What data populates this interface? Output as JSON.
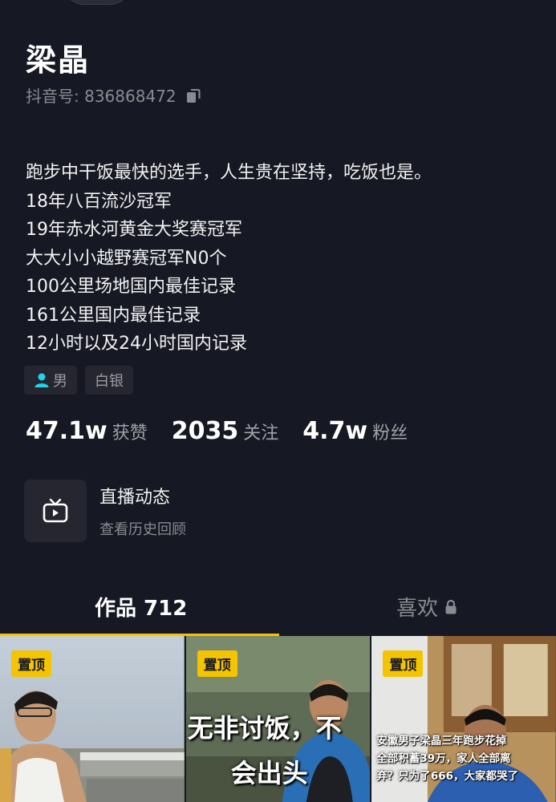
{
  "profile": {
    "name": "梁晶",
    "douyin_id_label": "抖音号: 836868472",
    "bio_lines": [
      "跑步中干饭最快的选手，人生贵在坚持，吃饭也是。",
      "18年八百流沙冠军",
      "19年赤水河黄金大奖赛冠军",
      "大大小小越野赛冠军N0个",
      "100公里场地国内最佳记录",
      "161公里国内最佳记录",
      "12小时以及24小时国内记录"
    ],
    "tags": {
      "gender": "男",
      "level": "白银"
    },
    "stats": [
      {
        "value": "47.1w",
        "label": "获赞"
      },
      {
        "value": "2035",
        "label": "关注"
      },
      {
        "value": "4.7w",
        "label": "粉丝"
      }
    ],
    "live": {
      "title": "直播动态",
      "subtitle": "查看历史回顾",
      "icon": "tv-icon"
    }
  },
  "tabs": [
    {
      "label": "作品 712",
      "active": true
    },
    {
      "label": "喜欢",
      "locked": true
    }
  ],
  "videos": [
    {
      "pin": "置顶",
      "caption": ""
    },
    {
      "pin": "置顶",
      "caption_lines": [
        "无非讨饭，不",
        "会出头"
      ]
    },
    {
      "pin": "置顶",
      "caption_lines": [
        "安徽男子梁晶三年跑步花掉",
        "全部积蓄39万，家人全部离",
        "弃？只为了666，大家都哭了"
      ]
    }
  ],
  "colors": {
    "background": "#161823",
    "accent": "#f5c400",
    "muted": "#8a8b91",
    "gender_icon": "#20d5ec"
  }
}
